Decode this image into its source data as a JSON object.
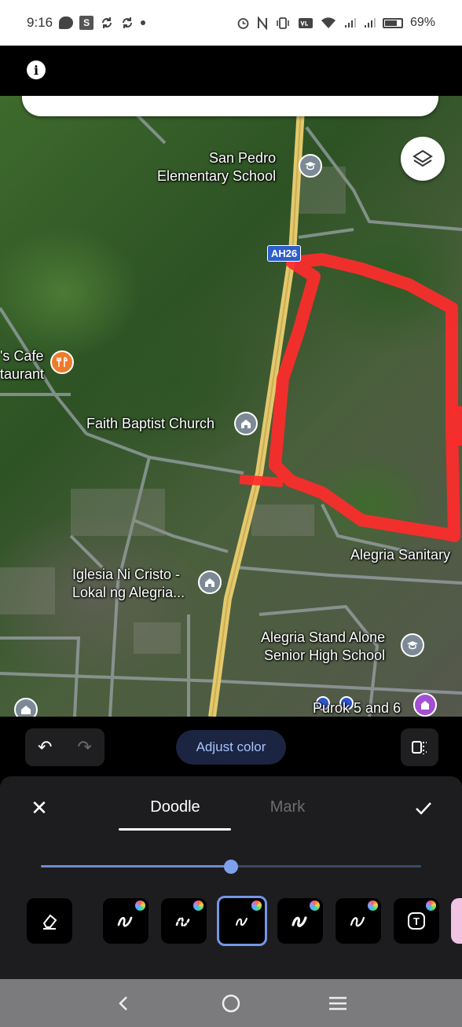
{
  "status_bar": {
    "time": "9:16",
    "sq_letter": "S",
    "battery_percent": "69%",
    "icons": [
      "chat-icon",
      "s-app-icon",
      "sync-icon",
      "sync-icon",
      "dot-icon",
      "alarm-icon",
      "nfc-icon",
      "vibrate-icon",
      "volte-icon",
      "wifi-icon",
      "signal-icon",
      "signal-icon",
      "battery-icon"
    ]
  },
  "top_bar": {
    "info_icon": "i"
  },
  "map": {
    "road_shield": "AH26",
    "labels": {
      "san_pedro": "San Pedro\nElementary School",
      "cafe": "'s Cafe\ntaurant",
      "faith_baptist": "Faith Baptist Church",
      "iglesia": "Iglesia Ni Cristo -\nLokal ng Alegria...",
      "alegria_sanitary": "Alegria Sanitary",
      "alegria_high": "Alegria Stand Alone\nSenior High School",
      "purok": "Purok 5 and 6"
    },
    "annotation_color": "#ff2b2b"
  },
  "editor": {
    "undo_icon": "↶",
    "redo_icon": "↷",
    "adjust_color_label": "Adjust color",
    "close_icon": "✕",
    "tabs": {
      "doodle": "Doodle",
      "mark": "Mark"
    },
    "active_tab": "Doodle",
    "brush_size_fraction": 0.5,
    "tools": [
      "eraser-icon",
      "pen-icon",
      "dotted-pen-icon",
      "marker-icon",
      "highlighter-icon",
      "brush-icon",
      "text-icon"
    ],
    "selected_tool_index": 3,
    "text_tool_letter": "T"
  },
  "colors": {
    "accent": "#7497e6",
    "adjust_text": "#a8c2ff",
    "annotation": "#ff2b2b"
  }
}
